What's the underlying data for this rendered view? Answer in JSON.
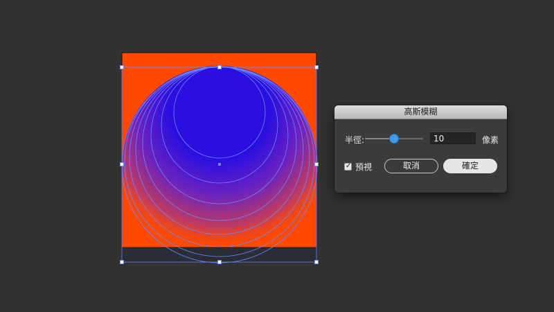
{
  "dialog": {
    "title": "高斯模糊",
    "radius_label": "半徑:",
    "radius_value": "10",
    "radius_unit": "像素",
    "slider_fraction": 0.5,
    "preview_label": "預視",
    "preview_checked": true,
    "cancel_label": "取消",
    "ok_label": "確定"
  },
  "colors": {
    "canvas_background": "#323232",
    "artboard_fill": "#ff4a00",
    "circle_top": "#2a0fe0",
    "circle_bottom": "#e24a2c",
    "selection_outline": "#6f86ff",
    "slider_accent": "#3d9bef"
  },
  "icons": {
    "checkbox_check": "checkmark-icon"
  }
}
